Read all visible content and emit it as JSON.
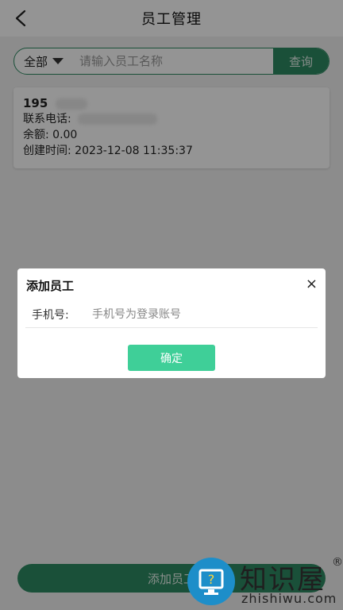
{
  "header": {
    "title": "员工管理"
  },
  "search": {
    "filter_label": "全部",
    "placeholder": "请输入员工名称",
    "button_label": "查询"
  },
  "employees": [
    {
      "name": "195",
      "phone_label": "联系电话:",
      "balance_label": "余额:",
      "balance": "0.00",
      "created_label": "创建时间:",
      "created_at": "2023-12-08 11:35:37"
    }
  ],
  "bottom": {
    "add_label": "添加员工"
  },
  "dialog": {
    "title": "添加员工",
    "close_symbol": "×",
    "phone_label": "手机号:",
    "phone_placeholder": "手机号为登录账号",
    "confirm_label": "确定"
  },
  "watermark": {
    "text": "知识屋",
    "reg": "®",
    "sub": "zhishiwu.com"
  },
  "colors": {
    "primary": "#2e8a62",
    "confirm": "#3fcf98",
    "overlay": "rgba(0,0,0,0.42)"
  }
}
